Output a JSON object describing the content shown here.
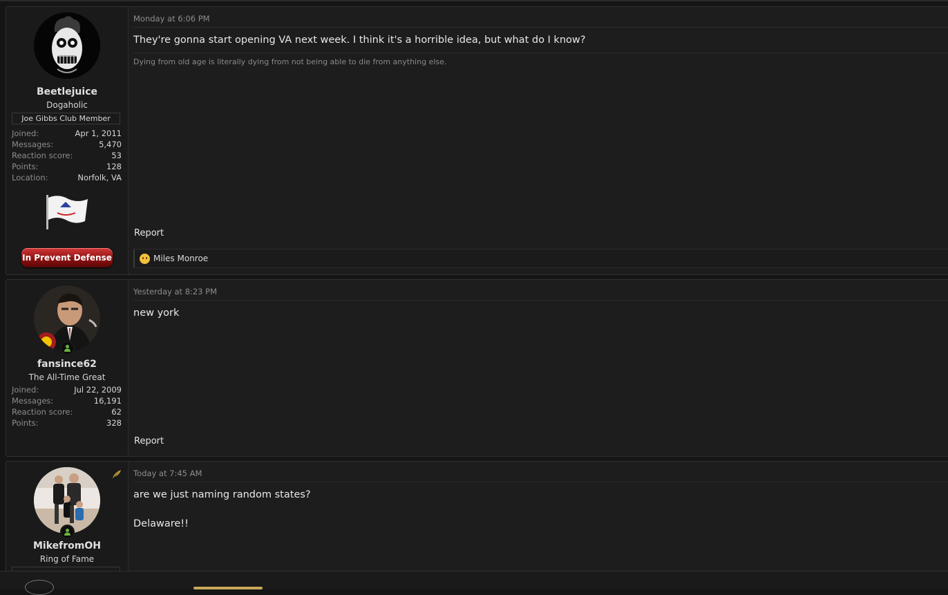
{
  "posts": [
    {
      "username": "Beetlejuice",
      "user_title": "Dogaholic",
      "banner": "Joe Gibbs Club Member",
      "stats": [
        {
          "label": "Joined:",
          "value": "Apr 1, 2011"
        },
        {
          "label": "Messages:",
          "value": "5,470"
        },
        {
          "label": "Reaction score:",
          "value": "53"
        },
        {
          "label": "Points:",
          "value": "128"
        },
        {
          "label": "Location:",
          "value": "Norfolk, VA"
        }
      ],
      "badge": "In Prevent Defense",
      "date": "Monday at 6:06 PM",
      "message": "They're gonna start opening VA next week. I think it's a horrible idea, but what do I know?",
      "signature": "Dying from old age is literally dying from not being able to die from anything else.",
      "report": "Report",
      "reactions": "Miles Monroe"
    },
    {
      "username": "fansince62",
      "user_title": "The All-Time Great",
      "stats": [
        {
          "label": "Joined:",
          "value": "Jul 22, 2009"
        },
        {
          "label": "Messages:",
          "value": "16,191"
        },
        {
          "label": "Reaction score:",
          "value": "62"
        },
        {
          "label": "Points:",
          "value": "328"
        }
      ],
      "date": "Yesterday at 8:23 PM",
      "message": "new york",
      "report": "Report"
    },
    {
      "username": "MikefromOH",
      "user_title": "Ring of Fame",
      "date": "Today at 7:45 AM",
      "message_lines": [
        "are we just naming random states?",
        "Delaware!!"
      ]
    }
  ],
  "colors": {
    "background": "#151515",
    "post_bg": "#1d1d1d",
    "online_green": "#6db33f",
    "badge_red": "#a51c1c"
  }
}
